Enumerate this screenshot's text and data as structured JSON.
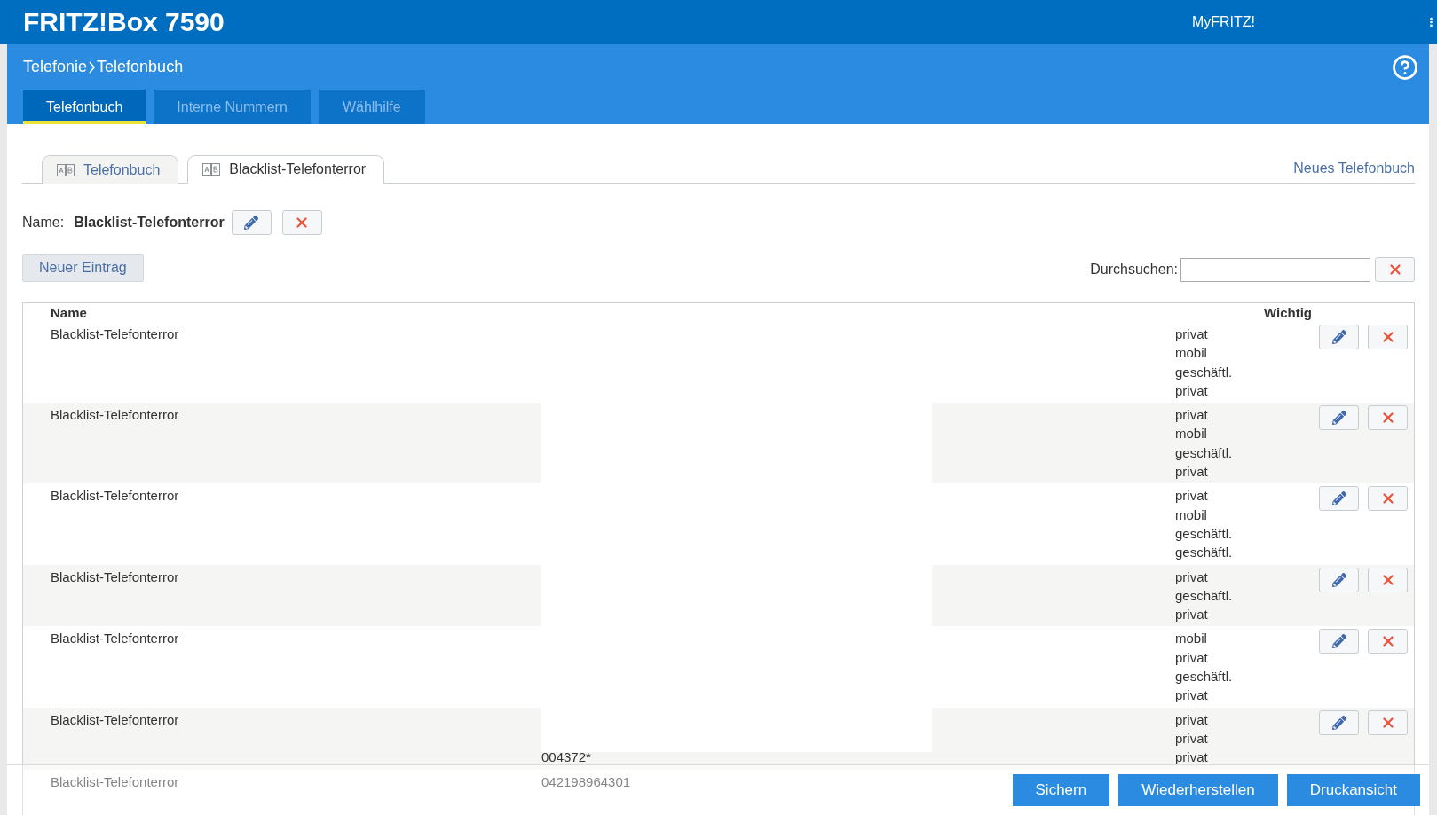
{
  "header": {
    "title": "FRITZ!Box 7590",
    "account_link": "MyFRITZ!"
  },
  "breadcrumb": [
    "Telefonie",
    "Telefonbuch"
  ],
  "nav_tabs": [
    {
      "label": "Telefonbuch",
      "selected": true
    },
    {
      "label": "Interne Nummern",
      "selected": false
    },
    {
      "label": "Wählhilfe",
      "selected": false
    }
  ],
  "phonebook_tabs": [
    {
      "label": "Telefonbuch",
      "selected": false
    },
    {
      "label": "Blacklist-Telefonterror",
      "selected": true
    }
  ],
  "new_phonebook_link": "Neues Telefonbuch",
  "name_row": {
    "label": "Name:",
    "value": "Blacklist-Telefonterror"
  },
  "new_entry_button": "Neuer Eintrag",
  "search": {
    "label": "Durchsuchen:"
  },
  "table": {
    "columns": [
      "Name",
      "Wichtig"
    ],
    "rows": [
      {
        "name": "Blacklist-Telefonterror",
        "types": [
          "privat",
          "mobil",
          "geschäftl.",
          "privat"
        ],
        "actions": true
      },
      {
        "name": "Blacklist-Telefonterror",
        "types": [
          "privat",
          "mobil",
          "geschäftl.",
          "privat"
        ],
        "actions": true
      },
      {
        "name": "Blacklist-Telefonterror",
        "types": [
          "privat",
          "mobil",
          "geschäftl.",
          "geschäftl."
        ],
        "actions": true
      },
      {
        "name": "Blacklist-Telefonterror",
        "types": [
          "privat",
          "geschäftl.",
          "privat"
        ],
        "actions": true
      },
      {
        "name": "Blacklist-Telefonterror",
        "types": [
          "mobil",
          "privat",
          "geschäftl.",
          "privat"
        ],
        "actions": true
      },
      {
        "name": "Blacklist-Telefonterror",
        "numbers": [
          "004372*"
        ],
        "types": [
          "privat",
          "privat",
          "privat"
        ],
        "actions": true
      },
      {
        "name": "Blacklist-Telefonterror",
        "numbers": [
          "042198964301"
        ],
        "actions": false
      }
    ]
  },
  "footer": {
    "buttons": [
      "Sichern",
      "Wiederherstellen",
      "Druckansicht"
    ]
  }
}
